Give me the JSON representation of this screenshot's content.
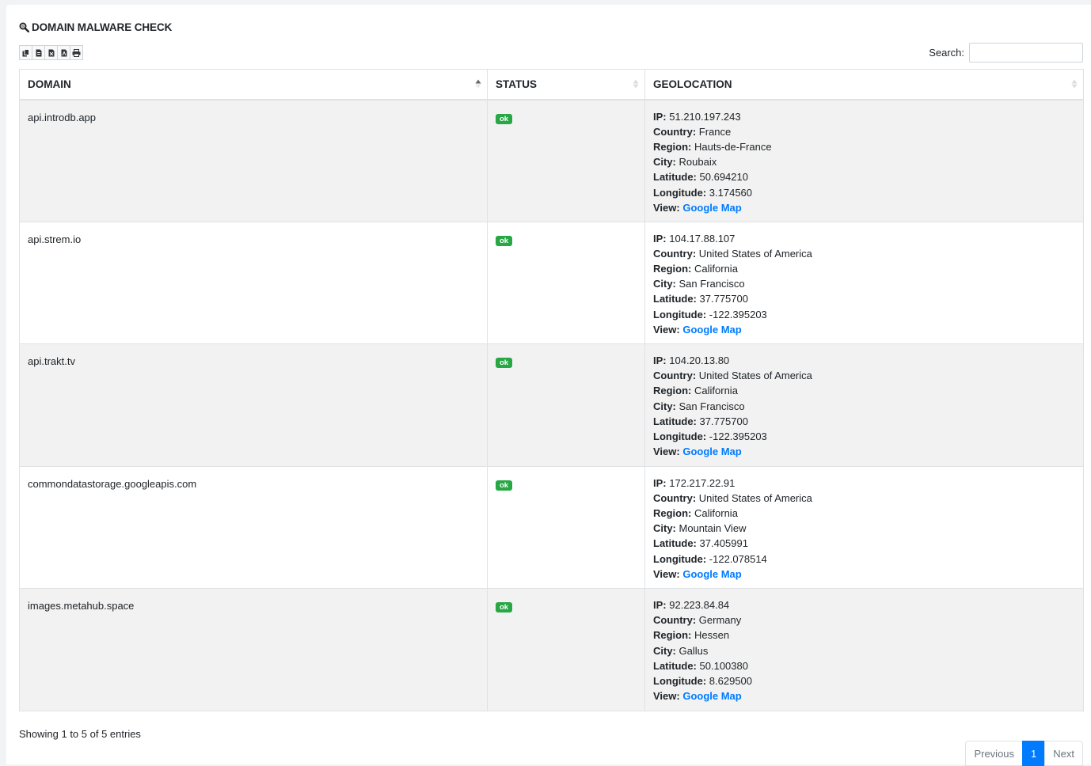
{
  "header": {
    "title": "DOMAIN MALWARE CHECK",
    "icon": "magnifier-icon"
  },
  "toolbar": {
    "buttons": [
      "copy-icon",
      "csv-icon",
      "excel-icon",
      "pdf-icon",
      "print-icon"
    ]
  },
  "search": {
    "label": "Search:",
    "value": ""
  },
  "table": {
    "columns": [
      "DOMAIN",
      "STATUS",
      "GEOLOCATION"
    ],
    "sort": {
      "column": "DOMAIN",
      "direction": "asc"
    },
    "labels": {
      "ip": "IP:",
      "country": "Country:",
      "region": "Region:",
      "city": "City:",
      "latitude": "Latitude:",
      "longitude": "Longitude:",
      "view": "View:"
    },
    "rows": [
      {
        "domain": "api.introdb.app",
        "status": "ok",
        "ip": "51.210.197.243",
        "country": "France",
        "region": "Hauts-de-France",
        "city": "Roubaix",
        "latitude": "50.694210",
        "longitude": "3.174560",
        "link": "Google Map"
      },
      {
        "domain": "api.strem.io",
        "status": "ok",
        "ip": "104.17.88.107",
        "country": "United States of America",
        "region": "California",
        "city": "San Francisco",
        "latitude": "37.775700",
        "longitude": "-122.395203",
        "link": "Google Map"
      },
      {
        "domain": "api.trakt.tv",
        "status": "ok",
        "ip": "104.20.13.80",
        "country": "United States of America",
        "region": "California",
        "city": "San Francisco",
        "latitude": "37.775700",
        "longitude": "-122.395203",
        "link": "Google Map"
      },
      {
        "domain": "commondatastorage.googleapis.com",
        "status": "ok",
        "ip": "172.217.22.91",
        "country": "United States of America",
        "region": "California",
        "city": "Mountain View",
        "latitude": "37.405991",
        "longitude": "-122.078514",
        "link": "Google Map"
      },
      {
        "domain": "images.metahub.space",
        "status": "ok",
        "ip": "92.223.84.84",
        "country": "Germany",
        "region": "Hessen",
        "city": "Gallus",
        "latitude": "50.100380",
        "longitude": "8.629500",
        "link": "Google Map"
      }
    ]
  },
  "footer": {
    "info": "Showing 1 to 5 of 5 entries",
    "pagination": {
      "previous": "Previous",
      "current": "1",
      "next": "Next"
    }
  },
  "colors": {
    "link": "#007bff",
    "badge": "#28a745",
    "active_page": "#007bff",
    "stripe": "#f2f2f2"
  }
}
